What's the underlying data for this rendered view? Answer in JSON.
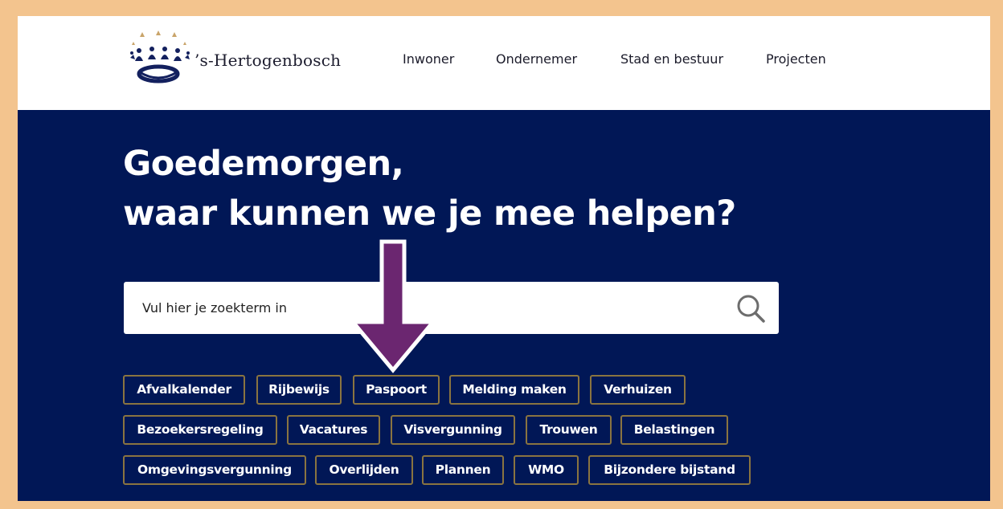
{
  "brand": {
    "name": "’s-Hertogenbosch",
    "logo_icon": "crown-logo-icon"
  },
  "nav": {
    "items": [
      {
        "label": "Inwoner"
      },
      {
        "label": "Ondernemer"
      },
      {
        "label": "Stad en bestuur"
      },
      {
        "label": "Projecten"
      }
    ]
  },
  "hero": {
    "title_line1": "Goedemorgen,",
    "title_line2": "waar kunnen we je mee helpen?"
  },
  "search": {
    "placeholder": "Vul hier je zoekterm in",
    "value": "",
    "icon": "search-icon"
  },
  "annotation": {
    "icon": "arrow-down-icon",
    "color": "#6b2670"
  },
  "quick_links": {
    "rows": [
      [
        {
          "label": "Afvalkalender"
        },
        {
          "label": "Rijbewijs"
        },
        {
          "label": "Paspoort"
        },
        {
          "label": "Melding maken"
        },
        {
          "label": "Verhuizen"
        }
      ],
      [
        {
          "label": "Bezoekersregeling"
        },
        {
          "label": "Vacatures"
        },
        {
          "label": "Visvergunning"
        },
        {
          "label": "Trouwen"
        },
        {
          "label": "Belastingen"
        }
      ],
      [
        {
          "label": "Omgevingsvergunning"
        },
        {
          "label": "Overlijden"
        },
        {
          "label": "Plannen"
        },
        {
          "label": "WMO"
        },
        {
          "label": "Bijzondere bijstand"
        }
      ]
    ]
  },
  "colors": {
    "hero_background": "#011756",
    "page_border": "#f3c48e",
    "tag_border": "#8a7440",
    "arrow": "#6b2670"
  }
}
